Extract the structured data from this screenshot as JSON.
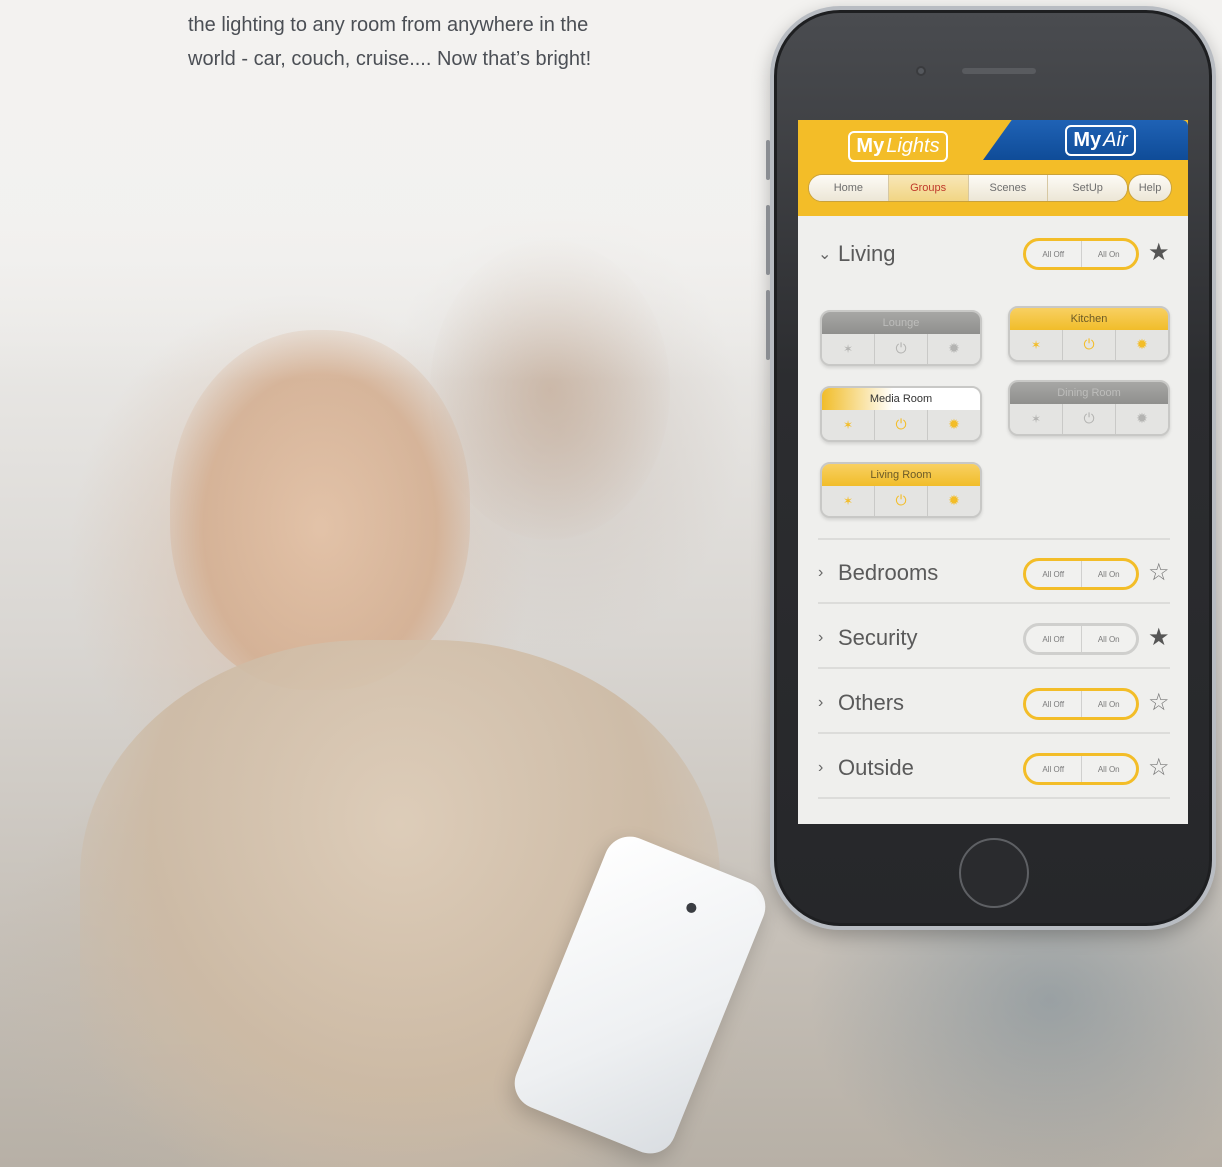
{
  "intro": {
    "line1": "the lighting to any room from anywhere in the",
    "line2": "world - car, couch, cruise.... Now that’s bright!"
  },
  "app": {
    "tabs": [
      {
        "my": "My",
        "product": "Lights",
        "active": true
      },
      {
        "my": "My",
        "product": "Air",
        "active": false
      }
    ],
    "nav": [
      {
        "label": "Home",
        "active": false
      },
      {
        "label": "Groups",
        "active": true
      },
      {
        "label": "Scenes",
        "active": false
      },
      {
        "label": "SetUp",
        "active": false
      }
    ],
    "help_label": "Help",
    "groups": [
      {
        "name": "Living",
        "expanded": true,
        "all_off": "All Off",
        "all_on": "All On",
        "favorite": true,
        "highlighted": true
      },
      {
        "name": "Bedrooms",
        "expanded": false,
        "all_off": "All Off",
        "all_on": "All On",
        "favorite": false,
        "highlighted": true
      },
      {
        "name": "Security",
        "expanded": false,
        "all_off": "All Off",
        "all_on": "All On",
        "favorite": true,
        "highlighted": false
      },
      {
        "name": "Others",
        "expanded": false,
        "all_off": "All Off",
        "all_on": "All On",
        "favorite": false,
        "highlighted": true
      },
      {
        "name": "Outside",
        "expanded": false,
        "all_off": "All Off",
        "all_on": "All On",
        "favorite": false,
        "highlighted": true
      }
    ],
    "living_lights": [
      {
        "name": "Lounge",
        "state": "off"
      },
      {
        "name": "Kitchen",
        "state": "on"
      },
      {
        "name": "Media Room",
        "state": "on"
      },
      {
        "name": "Dining Room",
        "state": "off"
      },
      {
        "name": "Living Room",
        "state": "on"
      }
    ],
    "colors": {
      "accent_yellow": "#f3bd28",
      "myair_blue": "#0f4c98"
    }
  }
}
